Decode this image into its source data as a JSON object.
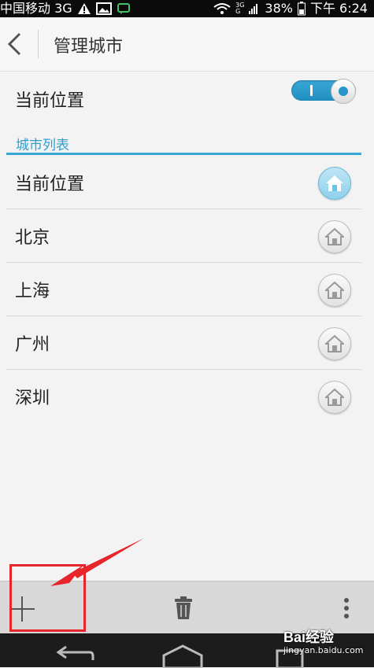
{
  "status_bar": {
    "carrier": "中国移动 3G",
    "network_small": [
      "3G",
      "G"
    ],
    "battery": "38%",
    "time": "下午 6:24"
  },
  "header": {
    "title": "管理城市"
  },
  "current_location": {
    "label": "当前位置",
    "toggle_on": true
  },
  "section": {
    "title": "城市列表"
  },
  "cities": [
    {
      "name": "当前位置",
      "is_home": true
    },
    {
      "name": "北京",
      "is_home": false
    },
    {
      "name": "上海",
      "is_home": false
    },
    {
      "name": "广州",
      "is_home": false
    },
    {
      "name": "深圳",
      "is_home": false
    }
  ],
  "action_bar": {
    "icons": [
      "add-icon",
      "trash-icon",
      "more-vert-icon"
    ]
  },
  "watermark": {
    "main": "Bai经验",
    "sub": "jingyan.baidu.com"
  },
  "colors": {
    "accent": "#38a7d6",
    "annotation": "#e6262b"
  }
}
